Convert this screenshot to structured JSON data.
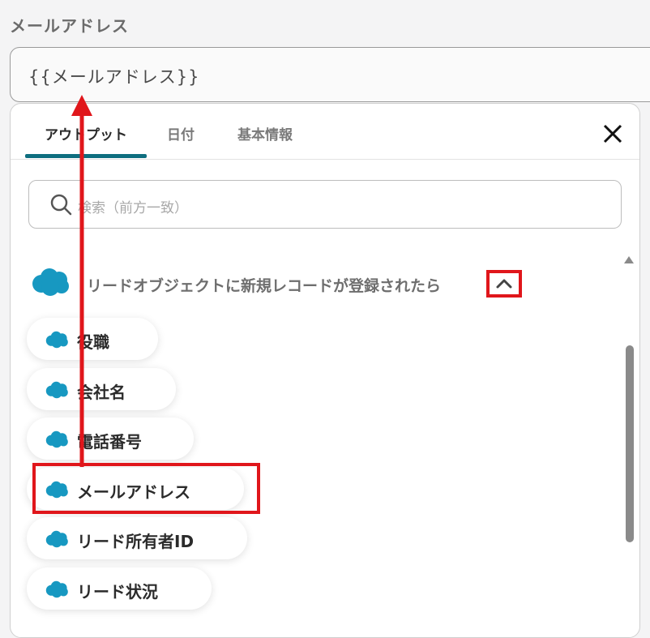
{
  "field": {
    "label": "メールアドレス",
    "value": "{{メールアドレス}}"
  },
  "tabs": [
    {
      "label": "アウトプット",
      "active": true
    },
    {
      "label": "日付",
      "active": false
    },
    {
      "label": "基本情報",
      "active": false
    }
  ],
  "search": {
    "placeholder": "検索（前方一致）",
    "icon": "search-icon"
  },
  "group": {
    "title": "リードオブジェクトに新規レコードが登録されたら",
    "icon": "salesforce-cloud-icon",
    "toggle_icon": "chevron-up-icon"
  },
  "items": [
    {
      "label": "役職"
    },
    {
      "label": "会社名"
    },
    {
      "label": "電話番号"
    },
    {
      "label": "メールアドレス",
      "highlighted": true
    },
    {
      "label": "リード所有者ID"
    },
    {
      "label": "リード状況"
    }
  ],
  "colors": {
    "tab_underline": "#0e6e7f",
    "salesforce_blue": "#1798c1",
    "annotation_red": "#e0161b"
  }
}
